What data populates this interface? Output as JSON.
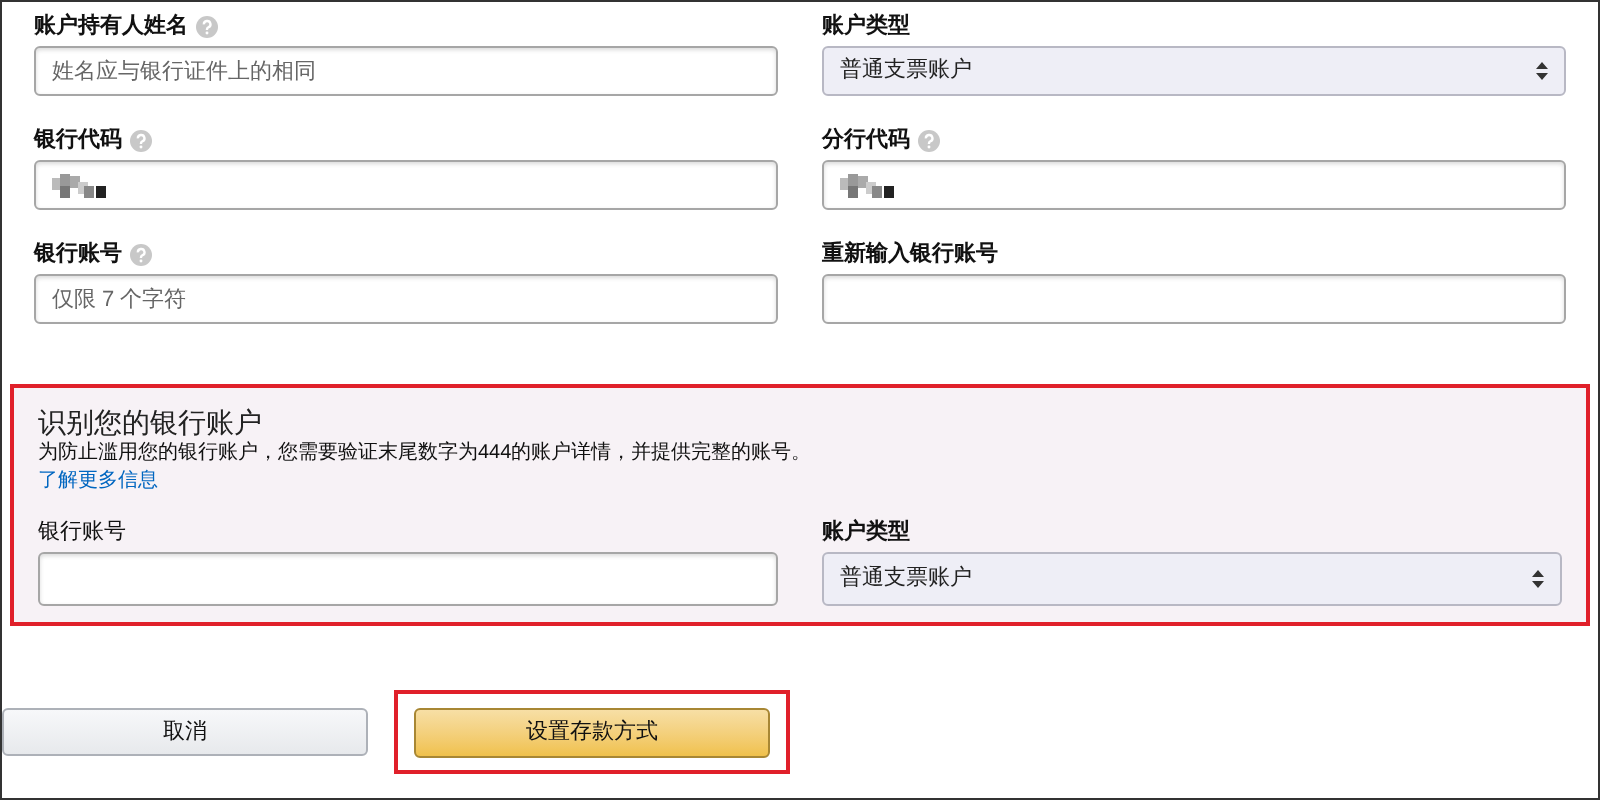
{
  "fields": [
    {
      "label": "账户持有人姓名",
      "help": true,
      "kind": "input",
      "placeholder": "姓名应与银行证件上的相同"
    },
    {
      "label": "账户类型",
      "help": false,
      "kind": "select",
      "value": "普通支票账户"
    },
    {
      "label": "银行代码",
      "help": true,
      "kind": "redacted"
    },
    {
      "label": "分行代码",
      "help": true,
      "kind": "redacted"
    },
    {
      "label": "银行账号",
      "help": true,
      "kind": "input",
      "placeholder": "仅限 7 个字符"
    },
    {
      "label": "重新输入银行账号",
      "help": false,
      "kind": "input"
    }
  ],
  "verify": {
    "title": "识别您的银行账户",
    "description": "为防止滥用您的银行账户，您需要验证末尾数字为444的账户详情，并提供完整的账号。",
    "link": "了解更多信息",
    "fields": [
      {
        "label": "银行账号",
        "help": false,
        "kind": "input"
      },
      {
        "label": "账户类型",
        "help": false,
        "kind": "select",
        "value": "普通支票账户"
      }
    ]
  },
  "buttons": [
    {
      "label": "取消",
      "kind": "secondary"
    },
    {
      "label": "设置存款方式",
      "kind": "primary"
    }
  ]
}
